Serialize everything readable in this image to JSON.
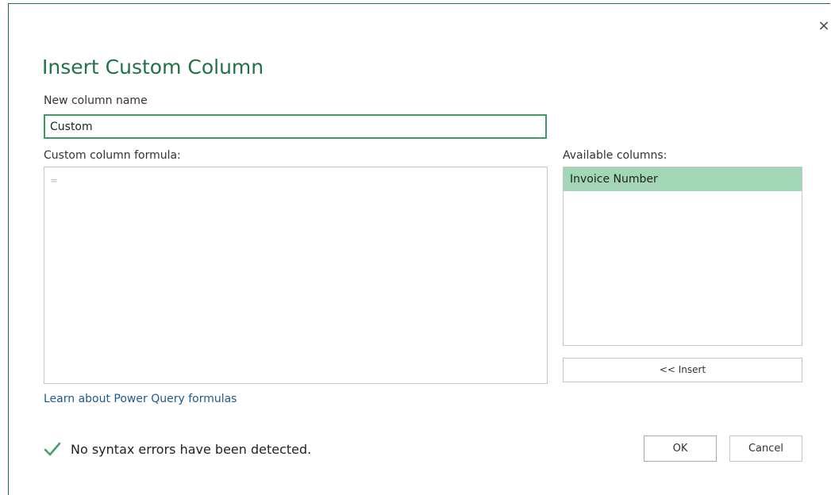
{
  "dialog": {
    "title": "Insert Custom Column",
    "close_glyph": "×",
    "close_icon": "close-icon"
  },
  "name_field": {
    "label": "New column name",
    "value": "Custom"
  },
  "formula": {
    "label": "Custom column formula:",
    "value": "="
  },
  "available_columns": {
    "label": "Available columns:",
    "items": [
      "Invoice Number"
    ],
    "selected_index": 0
  },
  "buttons": {
    "insert_label": "<< Insert",
    "ok_label": "OK",
    "cancel_label": "Cancel"
  },
  "learn_link": "Learn about Power Query formulas",
  "status": {
    "text": "No syntax errors have been detected.",
    "icon": "checkmark-icon"
  },
  "colors": {
    "accent": "#217346",
    "selected_bg": "#a3d6b7",
    "link": "#1e5a8c",
    "check": "#4a9e6b"
  }
}
